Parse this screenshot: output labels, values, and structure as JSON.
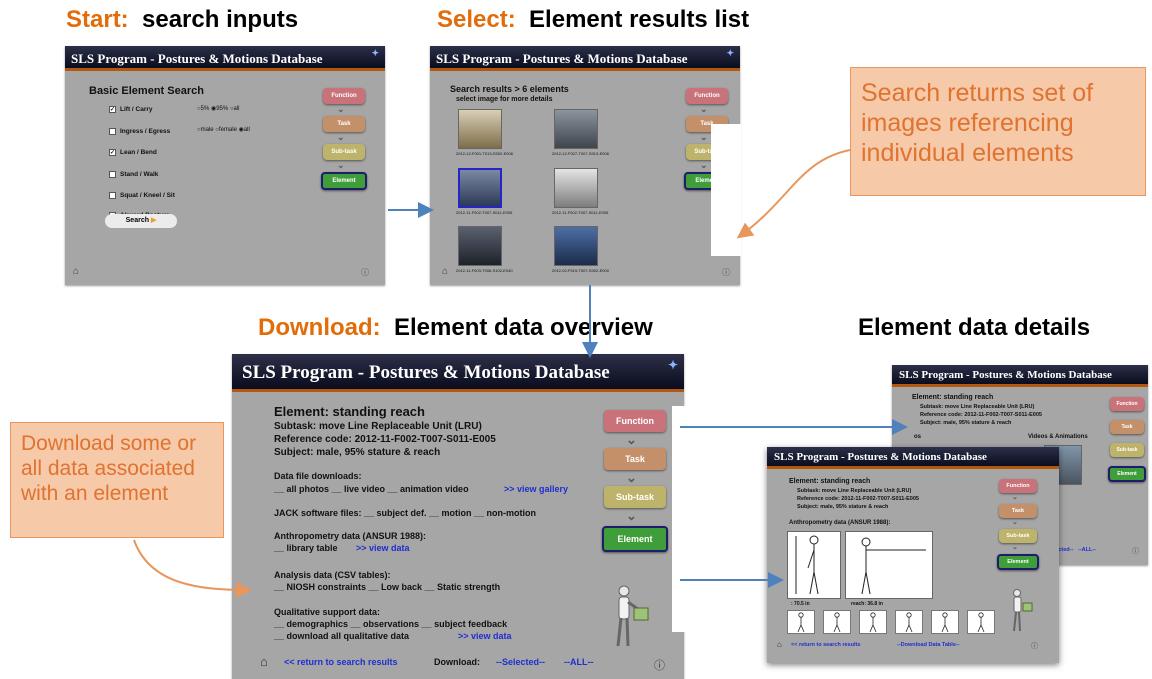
{
  "headings": {
    "start": {
      "kw": "Start:",
      "rest": "search inputs"
    },
    "select": {
      "kw": "Select:",
      "rest": "Element results list"
    },
    "download": {
      "kw": "Download:",
      "rest": "Element data overview"
    },
    "details": "Element data details"
  },
  "app_title": "SLS Program - Postures & Motions Database",
  "nav": {
    "function": "Function",
    "task": "Task",
    "subtask": "Sub-task",
    "element": "Element"
  },
  "search_panel": {
    "heading": "Basic Element Search",
    "options": [
      {
        "label": "Lift / Carry",
        "checked": true
      },
      {
        "label": "Ingress / Egress",
        "checked": false
      },
      {
        "label": "Lean / Bend",
        "checked": true
      },
      {
        "label": "Stand / Walk",
        "checked": false
      },
      {
        "label": "Squat / Kneel / Sit",
        "checked": false
      },
      {
        "label": "Akward Posture",
        "checked": false
      }
    ],
    "percentile": "○5%  ◉95%  ○all",
    "gender": "○male  ○female  ◉all",
    "search_button": "Search"
  },
  "results_panel": {
    "line1": "Search results > 6 elements",
    "line2": "select image for more details",
    "captions": [
      "2012-12-F001-T013-S002-E006",
      "2012-12-F027-T007-S013-E006",
      "2012-11-F002-T007-S011-E005",
      "2012-11-F002-T007-S011-E005",
      "2012-11-F003-T006-S102-E040",
      "2012-02-F019-T007-S002-E000"
    ]
  },
  "overview_panel": {
    "element": "Element:  standing reach",
    "subtask": "Subtask:  move Line Replaceable Unit (LRU)",
    "refcode": "Reference code:  2012-11-F002-T007-S011-E005",
    "subject": "Subject:  male, 95% stature & reach",
    "data_files_label": "Data file downloads:",
    "data_files": "__ all photos  __ live video  __ animation video",
    "view_gallery": ">> view gallery",
    "jack": "JACK software files:  __ subject def.  __ motion  __ non-motion",
    "anthro_label": "Anthropometry data (ANSUR 1988):",
    "anthro": "__ library table",
    "view_data": ">> view data",
    "analysis_label": "Analysis data (CSV tables):",
    "analysis": "__ NIOSH constraints  __ Low back  __ Static strength",
    "qual_label": "Qualitative support data:",
    "qual": "__ demographics  __ observations  __ subject feedback",
    "qual2": "__ download all qualitative data",
    "return": "<< return to search results",
    "download": "Download:",
    "selected": "--Selected--",
    "all": "--ALL--"
  },
  "details_back": {
    "element": "Element:  standing reach",
    "subtask": "Subtask:  move Line Replaceable Unit (LRU)",
    "refcode": "Reference code:  2012-11-F002-T007-S011-E005",
    "subject": "Subject:  male, 95% stature & reach",
    "photos": "os",
    "videos": "Videos & Animations",
    "selected": "Selected--",
    "all": "--ALL--"
  },
  "details_front": {
    "element": "Element:  standing reach",
    "subtask": "Subtask:  move Line Replaceable Unit (LRU)",
    "refcode": "Reference code:  2012-11-F002-T007-S011-E005",
    "subject": "Subject:  male, 95% stature & reach",
    "anthro": "Anthropometry data (ANSUR 1988):",
    "meas1": ":  70.5 in",
    "meas2": "reach:  36.8 in",
    "return": "<< return to search results",
    "download": "--Download Data Table--"
  },
  "callouts": {
    "search": "Search returns set of images referencing individual elements",
    "download": "Download some or all data associated with an element"
  },
  "colors": {
    "accent": "#e36c0a",
    "callout_bg": "#f6c9a9",
    "arrow": "#4f81bd"
  }
}
